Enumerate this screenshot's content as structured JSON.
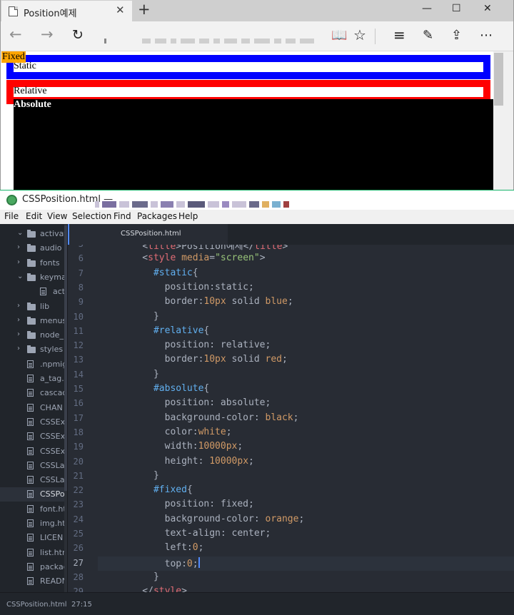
{
  "browser": {
    "tab_title": "Position예제",
    "tab_close": "✕",
    "new_tab": "+",
    "window_controls": {
      "minimize": "—",
      "maximize": "☐",
      "close": "✕"
    },
    "nav": {
      "back": "←",
      "forward": "→",
      "refresh": "↻"
    },
    "toolbar": {
      "reading_view": "📖",
      "favorite": "☆",
      "hub": "≡",
      "notes": "✎",
      "share": "⇪",
      "more": "⋯"
    },
    "page": {
      "fixed": "Fixed",
      "static": "Static",
      "relative": "Relative",
      "absolute": "Absolute"
    }
  },
  "atom": {
    "window_title": "CSSPosition.html —",
    "menu": [
      "File",
      "Edit",
      "View",
      "Selection",
      "Find",
      "Packages",
      "Help"
    ],
    "tree": [
      {
        "label": "activate-p",
        "type": "folder",
        "open": true
      },
      {
        "label": "audio",
        "type": "folder",
        "open": false
      },
      {
        "label": "fonts",
        "type": "folder",
        "open": false
      },
      {
        "label": "keyma",
        "type": "folder",
        "open": true
      },
      {
        "label": "act",
        "type": "file"
      },
      {
        "label": "lib",
        "type": "folder",
        "open": false
      },
      {
        "label": "menus",
        "type": "folder",
        "open": false
      },
      {
        "label": "node_",
        "type": "folder",
        "open": false
      },
      {
        "label": "styles",
        "type": "folder",
        "open": false
      },
      {
        "label": ".npmig",
        "type": "file"
      },
      {
        "label": "a_tag.l",
        "type": "file"
      },
      {
        "label": "cascac",
        "type": "file"
      },
      {
        "label": "CHAN",
        "type": "file"
      },
      {
        "label": "CSSEx",
        "type": "file"
      },
      {
        "label": "CSSEx",
        "type": "file"
      },
      {
        "label": "CSSEx",
        "type": "file"
      },
      {
        "label": "CSSLa",
        "type": "file"
      },
      {
        "label": "CSSLa",
        "type": "file"
      },
      {
        "label": "CSSPo",
        "type": "file",
        "selected": true
      },
      {
        "label": "font.ht",
        "type": "file"
      },
      {
        "label": "img.ht",
        "type": "file"
      },
      {
        "label": "LICEN",
        "type": "file"
      },
      {
        "label": "list.htr",
        "type": "file"
      },
      {
        "label": "packag",
        "type": "file"
      },
      {
        "label": "READN",
        "type": "file"
      }
    ],
    "active_tab": "CSSPosition.html",
    "code": {
      "current_line": "27",
      "lines": [
        {
          "num": "5",
          "tokens": [
            [
              "t-plain",
              "    "
            ],
            [
              "t-plain",
              "<"
            ],
            [
              "t-tag",
              "title"
            ],
            [
              "t-plain",
              ">Position예제</"
            ],
            [
              "t-tag",
              "title"
            ],
            [
              "t-plain",
              ">"
            ]
          ]
        },
        {
          "num": "6",
          "tokens": [
            [
              "t-plain",
              "    <"
            ],
            [
              "t-tag",
              "style"
            ],
            [
              "t-plain",
              " "
            ],
            [
              "t-attr",
              "media"
            ],
            [
              "t-plain",
              "="
            ],
            [
              "t-str",
              "\"screen\""
            ],
            [
              "t-plain",
              ">"
            ]
          ]
        },
        {
          "num": "7",
          "tokens": [
            [
              "t-plain",
              "      "
            ],
            [
              "t-sel",
              "#static"
            ],
            [
              "t-plain",
              "{"
            ]
          ]
        },
        {
          "num": "8",
          "tokens": [
            [
              "t-plain",
              "        position:static;"
            ]
          ]
        },
        {
          "num": "9",
          "tokens": [
            [
              "t-plain",
              "        border:"
            ],
            [
              "t-num",
              "10px"
            ],
            [
              "t-plain",
              " solid "
            ],
            [
              "t-kw",
              "blue"
            ],
            [
              "t-plain",
              ";"
            ]
          ]
        },
        {
          "num": "10",
          "tokens": [
            [
              "t-plain",
              "      }"
            ]
          ]
        },
        {
          "num": "11",
          "tokens": [
            [
              "t-plain",
              "      "
            ],
            [
              "t-sel",
              "#relative"
            ],
            [
              "t-plain",
              "{"
            ]
          ]
        },
        {
          "num": "12",
          "tokens": [
            [
              "t-plain",
              "        position: relative;"
            ]
          ]
        },
        {
          "num": "13",
          "tokens": [
            [
              "t-plain",
              "        border:"
            ],
            [
              "t-num",
              "10px"
            ],
            [
              "t-plain",
              " solid "
            ],
            [
              "t-kw",
              "red"
            ],
            [
              "t-plain",
              ";"
            ]
          ]
        },
        {
          "num": "14",
          "tokens": [
            [
              "t-plain",
              "      }"
            ]
          ]
        },
        {
          "num": "15",
          "tokens": [
            [
              "t-plain",
              "      "
            ],
            [
              "t-sel",
              "#absolute"
            ],
            [
              "t-plain",
              "{"
            ]
          ]
        },
        {
          "num": "16",
          "tokens": [
            [
              "t-plain",
              "        position: absolute;"
            ]
          ]
        },
        {
          "num": "17",
          "tokens": [
            [
              "t-plain",
              "        background-color: "
            ],
            [
              "t-kw",
              "black"
            ],
            [
              "t-plain",
              ";"
            ]
          ]
        },
        {
          "num": "18",
          "tokens": [
            [
              "t-plain",
              "        color:"
            ],
            [
              "t-kw",
              "white"
            ],
            [
              "t-plain",
              ";"
            ]
          ]
        },
        {
          "num": "19",
          "tokens": [
            [
              "t-plain",
              "        width:"
            ],
            [
              "t-num",
              "10000px"
            ],
            [
              "t-plain",
              ";"
            ]
          ]
        },
        {
          "num": "20",
          "tokens": [
            [
              "t-plain",
              "        height: "
            ],
            [
              "t-num",
              "10000px"
            ],
            [
              "t-plain",
              ";"
            ]
          ]
        },
        {
          "num": "21",
          "tokens": [
            [
              "t-plain",
              "      }"
            ]
          ]
        },
        {
          "num": "22",
          "tokens": [
            [
              "t-plain",
              "      "
            ],
            [
              "t-sel",
              "#fixed"
            ],
            [
              "t-plain",
              "{"
            ]
          ]
        },
        {
          "num": "23",
          "tokens": [
            [
              "t-plain",
              "        position: fixed;"
            ]
          ]
        },
        {
          "num": "24",
          "tokens": [
            [
              "t-plain",
              "        background-color: "
            ],
            [
              "t-kw",
              "orange"
            ],
            [
              "t-plain",
              ";"
            ]
          ]
        },
        {
          "num": "25",
          "tokens": [
            [
              "t-plain",
              "        text-align: center;"
            ]
          ]
        },
        {
          "num": "26",
          "tokens": [
            [
              "t-plain",
              "        left:"
            ],
            [
              "t-num",
              "0"
            ],
            [
              "t-plain",
              ";"
            ]
          ]
        },
        {
          "num": "27",
          "tokens": [
            [
              "t-plain",
              "        top:"
            ],
            [
              "t-num",
              "0"
            ],
            [
              "t-plain",
              ";"
            ]
          ]
        },
        {
          "num": "28",
          "tokens": [
            [
              "t-plain",
              "      }"
            ]
          ]
        },
        {
          "num": "29",
          "tokens": [
            [
              "t-plain",
              "    </"
            ],
            [
              "t-tag",
              "style"
            ],
            [
              "t-plain",
              ">"
            ]
          ]
        }
      ]
    },
    "status": {
      "file": "CSSPosition.html",
      "position": "27:15"
    }
  },
  "colors": {
    "static_border": "#0000ff",
    "relative_border": "#ff0000",
    "absolute_bg": "#000000",
    "fixed_bg": "#ffa500",
    "editor_bg": "#282c34",
    "tree_bg": "#21252b"
  }
}
